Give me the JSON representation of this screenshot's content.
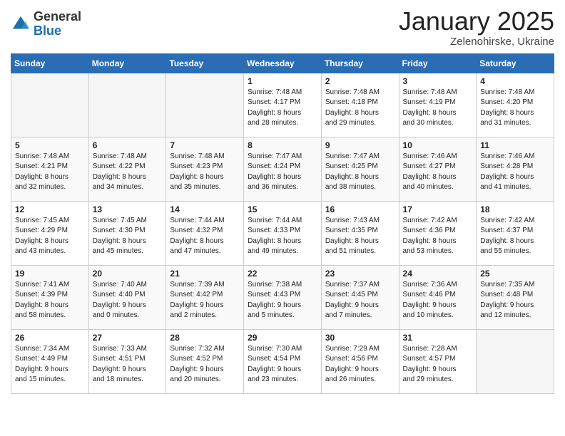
{
  "logo": {
    "general": "General",
    "blue": "Blue"
  },
  "title": "January 2025",
  "subtitle": "Zelenohirske, Ukraine",
  "weekdays": [
    "Sunday",
    "Monday",
    "Tuesday",
    "Wednesday",
    "Thursday",
    "Friday",
    "Saturday"
  ],
  "weeks": [
    [
      {
        "day": "",
        "info": ""
      },
      {
        "day": "",
        "info": ""
      },
      {
        "day": "",
        "info": ""
      },
      {
        "day": "1",
        "info": "Sunrise: 7:48 AM\nSunset: 4:17 PM\nDaylight: 8 hours\nand 28 minutes."
      },
      {
        "day": "2",
        "info": "Sunrise: 7:48 AM\nSunset: 4:18 PM\nDaylight: 8 hours\nand 29 minutes."
      },
      {
        "day": "3",
        "info": "Sunrise: 7:48 AM\nSunset: 4:19 PM\nDaylight: 8 hours\nand 30 minutes."
      },
      {
        "day": "4",
        "info": "Sunrise: 7:48 AM\nSunset: 4:20 PM\nDaylight: 8 hours\nand 31 minutes."
      }
    ],
    [
      {
        "day": "5",
        "info": "Sunrise: 7:48 AM\nSunset: 4:21 PM\nDaylight: 8 hours\nand 32 minutes."
      },
      {
        "day": "6",
        "info": "Sunrise: 7:48 AM\nSunset: 4:22 PM\nDaylight: 8 hours\nand 34 minutes."
      },
      {
        "day": "7",
        "info": "Sunrise: 7:48 AM\nSunset: 4:23 PM\nDaylight: 8 hours\nand 35 minutes."
      },
      {
        "day": "8",
        "info": "Sunrise: 7:47 AM\nSunset: 4:24 PM\nDaylight: 8 hours\nand 36 minutes."
      },
      {
        "day": "9",
        "info": "Sunrise: 7:47 AM\nSunset: 4:25 PM\nDaylight: 8 hours\nand 38 minutes."
      },
      {
        "day": "10",
        "info": "Sunrise: 7:46 AM\nSunset: 4:27 PM\nDaylight: 8 hours\nand 40 minutes."
      },
      {
        "day": "11",
        "info": "Sunrise: 7:46 AM\nSunset: 4:28 PM\nDaylight: 8 hours\nand 41 minutes."
      }
    ],
    [
      {
        "day": "12",
        "info": "Sunrise: 7:45 AM\nSunset: 4:29 PM\nDaylight: 8 hours\nand 43 minutes."
      },
      {
        "day": "13",
        "info": "Sunrise: 7:45 AM\nSunset: 4:30 PM\nDaylight: 8 hours\nand 45 minutes."
      },
      {
        "day": "14",
        "info": "Sunrise: 7:44 AM\nSunset: 4:32 PM\nDaylight: 8 hours\nand 47 minutes."
      },
      {
        "day": "15",
        "info": "Sunrise: 7:44 AM\nSunset: 4:33 PM\nDaylight: 8 hours\nand 49 minutes."
      },
      {
        "day": "16",
        "info": "Sunrise: 7:43 AM\nSunset: 4:35 PM\nDaylight: 8 hours\nand 51 minutes."
      },
      {
        "day": "17",
        "info": "Sunrise: 7:42 AM\nSunset: 4:36 PM\nDaylight: 8 hours\nand 53 minutes."
      },
      {
        "day": "18",
        "info": "Sunrise: 7:42 AM\nSunset: 4:37 PM\nDaylight: 8 hours\nand 55 minutes."
      }
    ],
    [
      {
        "day": "19",
        "info": "Sunrise: 7:41 AM\nSunset: 4:39 PM\nDaylight: 8 hours\nand 58 minutes."
      },
      {
        "day": "20",
        "info": "Sunrise: 7:40 AM\nSunset: 4:40 PM\nDaylight: 9 hours\nand 0 minutes."
      },
      {
        "day": "21",
        "info": "Sunrise: 7:39 AM\nSunset: 4:42 PM\nDaylight: 9 hours\nand 2 minutes."
      },
      {
        "day": "22",
        "info": "Sunrise: 7:38 AM\nSunset: 4:43 PM\nDaylight: 9 hours\nand 5 minutes."
      },
      {
        "day": "23",
        "info": "Sunrise: 7:37 AM\nSunset: 4:45 PM\nDaylight: 9 hours\nand 7 minutes."
      },
      {
        "day": "24",
        "info": "Sunrise: 7:36 AM\nSunset: 4:46 PM\nDaylight: 9 hours\nand 10 minutes."
      },
      {
        "day": "25",
        "info": "Sunrise: 7:35 AM\nSunset: 4:48 PM\nDaylight: 9 hours\nand 12 minutes."
      }
    ],
    [
      {
        "day": "26",
        "info": "Sunrise: 7:34 AM\nSunset: 4:49 PM\nDaylight: 9 hours\nand 15 minutes."
      },
      {
        "day": "27",
        "info": "Sunrise: 7:33 AM\nSunset: 4:51 PM\nDaylight: 9 hours\nand 18 minutes."
      },
      {
        "day": "28",
        "info": "Sunrise: 7:32 AM\nSunset: 4:52 PM\nDaylight: 9 hours\nand 20 minutes."
      },
      {
        "day": "29",
        "info": "Sunrise: 7:30 AM\nSunset: 4:54 PM\nDaylight: 9 hours\nand 23 minutes."
      },
      {
        "day": "30",
        "info": "Sunrise: 7:29 AM\nSunset: 4:56 PM\nDaylight: 9 hours\nand 26 minutes."
      },
      {
        "day": "31",
        "info": "Sunrise: 7:28 AM\nSunset: 4:57 PM\nDaylight: 9 hours\nand 29 minutes."
      },
      {
        "day": "",
        "info": ""
      }
    ]
  ]
}
